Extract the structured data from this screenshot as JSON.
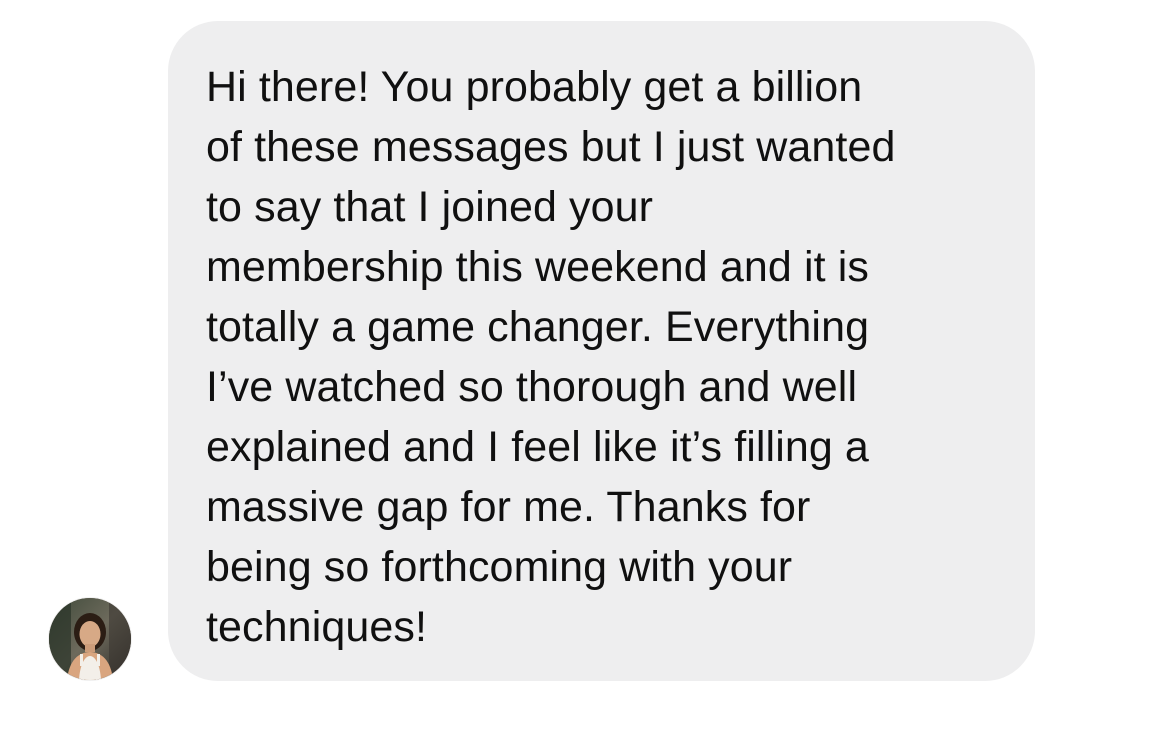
{
  "conversation": {
    "message": {
      "sender_avatar_icon": "user-avatar-photo",
      "text": "Hi there! You probably get a billion\nof these messages but I just wanted\nto say that I joined your\nmembership this weekend and it is\ntotally a game changer. Everything\nI’ve watched so thorough and well\nexplained and I feel like it’s filling a\nmassive gap for me. Thanks for\nbeing so forthcoming with your\ntechniques!",
      "bubble_color": "#eeeeef",
      "text_color": "#101010"
    }
  }
}
